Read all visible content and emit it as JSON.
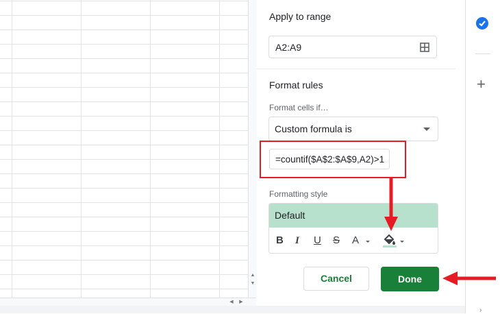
{
  "panel": {
    "apply_to_range_title": "Apply to range",
    "range_value": "A2:A9",
    "format_rules_title": "Format rules",
    "format_cells_if_label": "Format cells if…",
    "condition_selected": "Custom formula is",
    "formula_value": "=countif($A$2:$A$9,A2)>1",
    "formatting_style_label": "Formatting style",
    "style_preset": "Default",
    "style_fill_color": "#b7e1cd",
    "toolbar": {
      "bold": "B",
      "italic": "I",
      "underline": "U",
      "strikethrough": "S",
      "text_color": "A"
    },
    "cancel_label": "Cancel",
    "done_label": "Done",
    "accent_color": "#188038"
  },
  "rail": {
    "items": [
      "tasks-check-icon",
      "add-icon"
    ]
  },
  "annotations": {
    "highlight_color": "#e51c23"
  }
}
